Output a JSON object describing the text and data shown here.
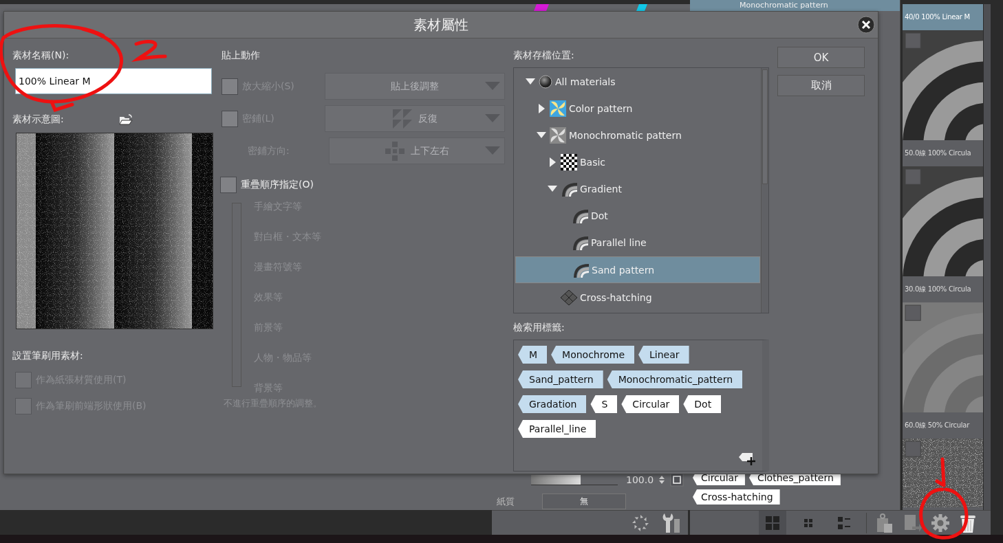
{
  "dialog": {
    "title": "素材屬性",
    "name_field": {
      "label": "素材名稱(N):",
      "value": "100% Linear M"
    },
    "thumbnail": {
      "label": "素材示意圖:"
    },
    "brush_use": {
      "label": "設置筆刷用素材:",
      "options": [
        {
          "label": "作為紙張材質使用(T)",
          "checked": false,
          "disabled": true
        },
        {
          "label": "作為筆刷前端形狀使用(B)",
          "checked": false,
          "disabled": true
        }
      ]
    },
    "paste_action": {
      "label": "貼上動作",
      "disabled": true,
      "rows": [
        {
          "kind": "scale",
          "label": "放大縮小(S)",
          "checked": false,
          "value": "貼上後調整"
        },
        {
          "kind": "tile",
          "label": "密鋪(L)",
          "checked": false,
          "value": "反復"
        },
        {
          "kind": "direction",
          "label": "密鋪方向:",
          "value": "上下左右"
        }
      ]
    },
    "layer_order": {
      "label": "重疊順序指定(O)",
      "checked": false,
      "items": [
        "手繪文字等",
        "對白框・文本等",
        "漫畫符號等",
        "效果等",
        "前景等",
        "人物・物品等",
        "背景等"
      ],
      "note": "不進行重疊順序的調整。"
    },
    "location": {
      "label": "素材存檔位置:",
      "tree": [
        {
          "kind": "root",
          "label": "All materials",
          "expanded": true,
          "selected": false,
          "children": [
            {
              "kind": "color",
              "label": "Color pattern",
              "expanded": false,
              "selected": false
            },
            {
              "kind": "mono",
              "label": "Monochromatic pattern",
              "expanded": true,
              "selected": false,
              "children": [
                {
                  "kind": "checker",
                  "label": "Basic",
                  "expanded": false,
                  "selected": false
                },
                {
                  "kind": "gradient",
                  "label": "Gradient",
                  "expanded": true,
                  "selected": false,
                  "children": [
                    {
                      "kind": "gradient",
                      "label": "Dot",
                      "selected": false
                    },
                    {
                      "kind": "gradient",
                      "label": "Parallel line",
                      "selected": false
                    },
                    {
                      "kind": "gradient",
                      "label": "Sand pattern",
                      "selected": true
                    }
                  ]
                },
                {
                  "kind": "hatch",
                  "label": "Cross-hatching",
                  "selected": false
                }
              ]
            }
          ]
        }
      ]
    },
    "tags": {
      "label": "檢索用標籤:",
      "items": [
        {
          "label": "M",
          "color": "#c4dcee"
        },
        {
          "label": "Monochrome",
          "color": "#c4dcee"
        },
        {
          "label": "Linear",
          "color": "#c4dcee"
        },
        {
          "label": "Sand_pattern",
          "color": "#c4dcee"
        },
        {
          "label": "Monochromatic_pattern",
          "color": "#c4dcee"
        },
        {
          "label": "Gradation",
          "color": "#c4dcee"
        },
        {
          "label": "S",
          "color": "#ffffff"
        },
        {
          "label": "Circular",
          "color": "#ffffff"
        },
        {
          "label": "Dot",
          "color": "#ffffff"
        },
        {
          "label": "Parallel_line",
          "color": "#ffffff"
        }
      ]
    },
    "buttons": [
      {
        "label": "OK"
      },
      {
        "label": "取消"
      }
    ]
  },
  "app": {
    "header": "Monochromatic pattern",
    "slider": {
      "level": 0.57,
      "reading": "100.0"
    },
    "paper": {
      "label": "紙質",
      "value": "無"
    },
    "tags": [
      "Circular",
      "Clothes_pattern",
      "Cross-hatching"
    ],
    "thumbnails": [
      {
        "caption": "40/0 100% Linear M",
        "selected": true
      },
      {
        "caption": "50.0線 100% Circula",
        "selected": false
      },
      {
        "caption": "30.0線 100% Circula",
        "selected": false
      },
      {
        "caption": "60.0線 50% Circular",
        "selected": false
      }
    ],
    "view_modes": [
      {
        "selected": true
      },
      {
        "selected": false
      },
      {
        "selected": false
      }
    ]
  }
}
